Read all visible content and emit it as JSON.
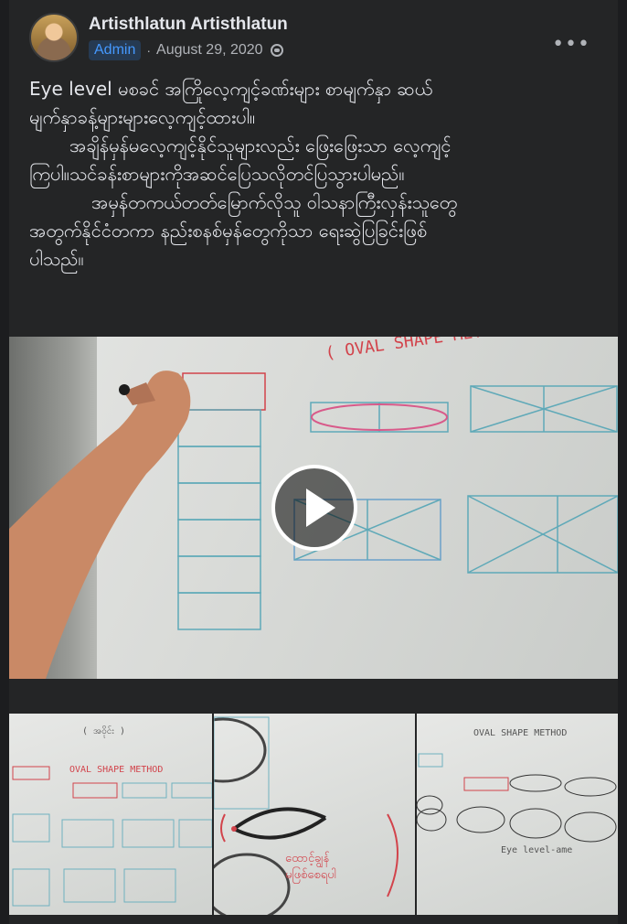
{
  "post": {
    "author": "Artisthlatun Artisthlatun",
    "badge": "Admin",
    "date": "August 29, 2020",
    "separator": "·",
    "visibility_icon": "audience-icon",
    "more_icon": "more-options-icon",
    "text_lines": [
      "Eye level မစခင် အကြိုလေ့ကျင့်ခဏ်းများ စာမျက်နှာ ဆယ်",
      "မျက်နှာခန့်များများလေ့ကျင့်ထားပါ။",
      "အချိန်မှန်မလေ့ကျင့်နိုင်သူများလည်း ဖြေးဖြေးသာ လေ့ကျင့်",
      "ကြပါ။သင်ခန်းစာများကိုအဆင်ပြေသလိုတင်ပြသွားပါမည်။",
      "အမှန်တကယ်တတ်မြောက်လိုသူ ဝါသနာကြီးလှန်းသူတွေ",
      "အတွက်နိုင်ငံတကာ နည်းစနစ်မှန်တွေကိုသာ ရေးဆွဲပြခြင်းဖြစ်",
      "ပါသည်။"
    ]
  },
  "video": {
    "play_icon": "play-icon",
    "board_heading": "( OVAL SHAPE METHOD"
  },
  "thumbnails": [
    {
      "label_top": "OVAL SHAPE METHOD",
      "label_sub": "( အဝိုင်း )"
    },
    {
      "label_top": "ထောင့်ချွန်",
      "label_sub": "မဖြစ်စေရပါ"
    },
    {
      "label_top": "OVAL SHAPE METHOD",
      "label_sub": "Eye level-ame"
    }
  ]
}
